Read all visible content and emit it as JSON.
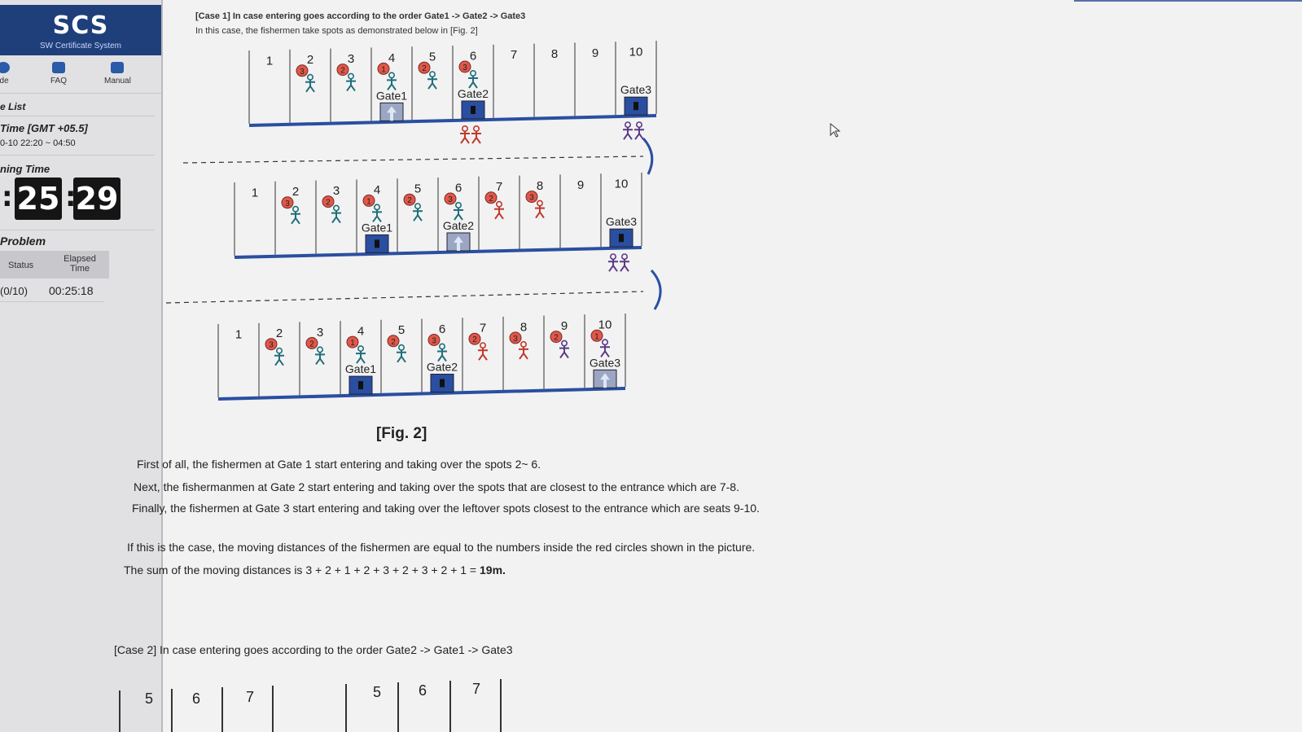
{
  "sidebar": {
    "logo": "SCS",
    "logo_sub": "SW Certificate System",
    "nav": [
      {
        "icon": "info-icon",
        "label": "ide"
      },
      {
        "icon": "faq-icon",
        "label": "FAQ"
      },
      {
        "icon": "manual-icon",
        "label": "Manual"
      }
    ],
    "list_label": "e List",
    "time_label": "Time [GMT +05.5]",
    "time_range": "0-10 22:20 ~ 04:50",
    "remaining_label": "ning Time",
    "timer": {
      "prefix": ":",
      "minutes": "25",
      "seconds": "29"
    },
    "problem_label": "Problem",
    "status_header": "Status",
    "elapsed_header": "Elapsed Time",
    "status_value": "(0/10)",
    "elapsed_value": "00:25:18"
  },
  "content": {
    "case1_line1": "[Case 1] In case entering goes according to the order Gate1 -> Gate2 -> Gate3",
    "case1_line2": "In this case, the fishermen take spots as demonstrated below in [Fig. 2]",
    "fig_caption": "[Fig. 2]",
    "para1": "First of all, the fishermen at Gate 1 start entering and taking over the spots 2~ 6.",
    "para2": "Next, the fishermanmen at Gate 2 start entering and taking over the spots that are closest to the entrance which are 7-8.",
    "para3": "Finally, the fishermen at Gate 3 start entering and taking over the leftover spots closest to the entrance which are seats 9-10.",
    "para4": "If this is the case, the moving distances of the fishermen are equal to the numbers inside the red circles shown in the picture.",
    "para5_prefix": "The sum of the moving distances is 3 + 2 + 1 + 2 + 3 + 2 + 3 + 2 + 1 = ",
    "para5_total": "19m.",
    "case2": "[Case 2] In case entering goes according to the order Gate2 -> Gate1 -> Gate3"
  },
  "figure": {
    "spots": [
      "1",
      "2",
      "3",
      "4",
      "5",
      "6",
      "7",
      "8",
      "9",
      "10"
    ],
    "gates": [
      "Gate1",
      "Gate2",
      "Gate3"
    ],
    "colors": {
      "gate_blue": "#2a4fa0",
      "circle_red": "#e0584a",
      "fisher_teal": "#1f6f7a",
      "fisher_red": "#c0392b",
      "fisher_purple": "#5b3a86"
    },
    "row1": {
      "distances": [
        "3",
        "2",
        "1",
        "2",
        "3"
      ]
    },
    "row2": {
      "distances": [
        "3",
        "2",
        "1",
        "2",
        "3",
        "2",
        "3"
      ]
    },
    "row3": {
      "distances": [
        "3",
        "2",
        "1",
        "2",
        "3",
        "2",
        "3",
        "2",
        "1"
      ]
    }
  },
  "case2_preview": {
    "left_spots": [
      "5",
      "6",
      "7"
    ],
    "right_spots": [
      "5",
      "6",
      "7"
    ]
  }
}
